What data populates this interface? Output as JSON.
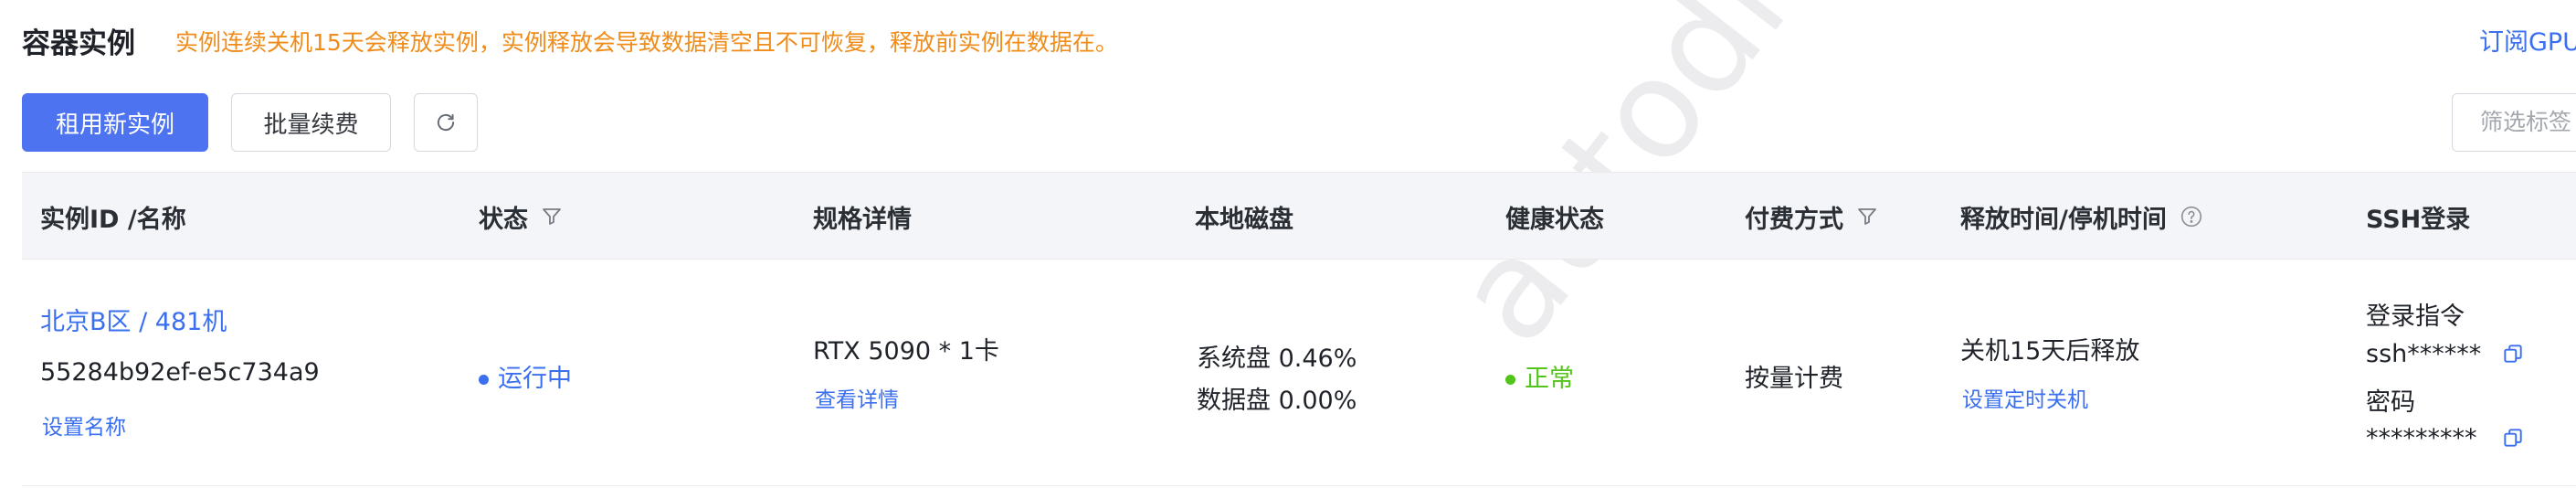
{
  "header": {
    "title": "容器实例",
    "notice": "实例连续关机15天会释放实例，实例释放会导致数据清空且不可恢复，释放前实例在数据在。",
    "subscribe_link": "订阅GPU"
  },
  "toolbar": {
    "rent_button": "租用新实例",
    "batch_renew_button": "批量续费",
    "refresh_icon": "refresh-icon",
    "filter_placeholder": "筛选标签"
  },
  "table": {
    "columns": {
      "instance": "实例ID /名称",
      "status": "状态",
      "spec": "规格详情",
      "disk": "本地磁盘",
      "health": "健康状态",
      "billing": "付费方式",
      "release": "释放时间/停机时间",
      "ssh": "SSH登录"
    },
    "rows": [
      {
        "name": "北京B区 / 481机",
        "id": "55284b92ef-e5c734a9",
        "set_name": "设置名称",
        "status": "运行中",
        "spec": "RTX 5090 * 1卡",
        "view_details": "查看详情",
        "system_disk": "系统盘 0.46%",
        "data_disk": "数据盘 0.00%",
        "health": "正常",
        "billing": "按量计费",
        "release": "关机15天后释放",
        "set_shutdown": "设置定时关机",
        "ssh_command_label": "登录指令",
        "ssh_command": "ssh******",
        "password_label": "密码",
        "password": "*********"
      }
    ]
  },
  "colors": {
    "primary": "#4d73f0",
    "link": "#3a6ff0",
    "warning": "#f08c1a",
    "success": "#52c41a"
  },
  "watermark": "autodl.com"
}
